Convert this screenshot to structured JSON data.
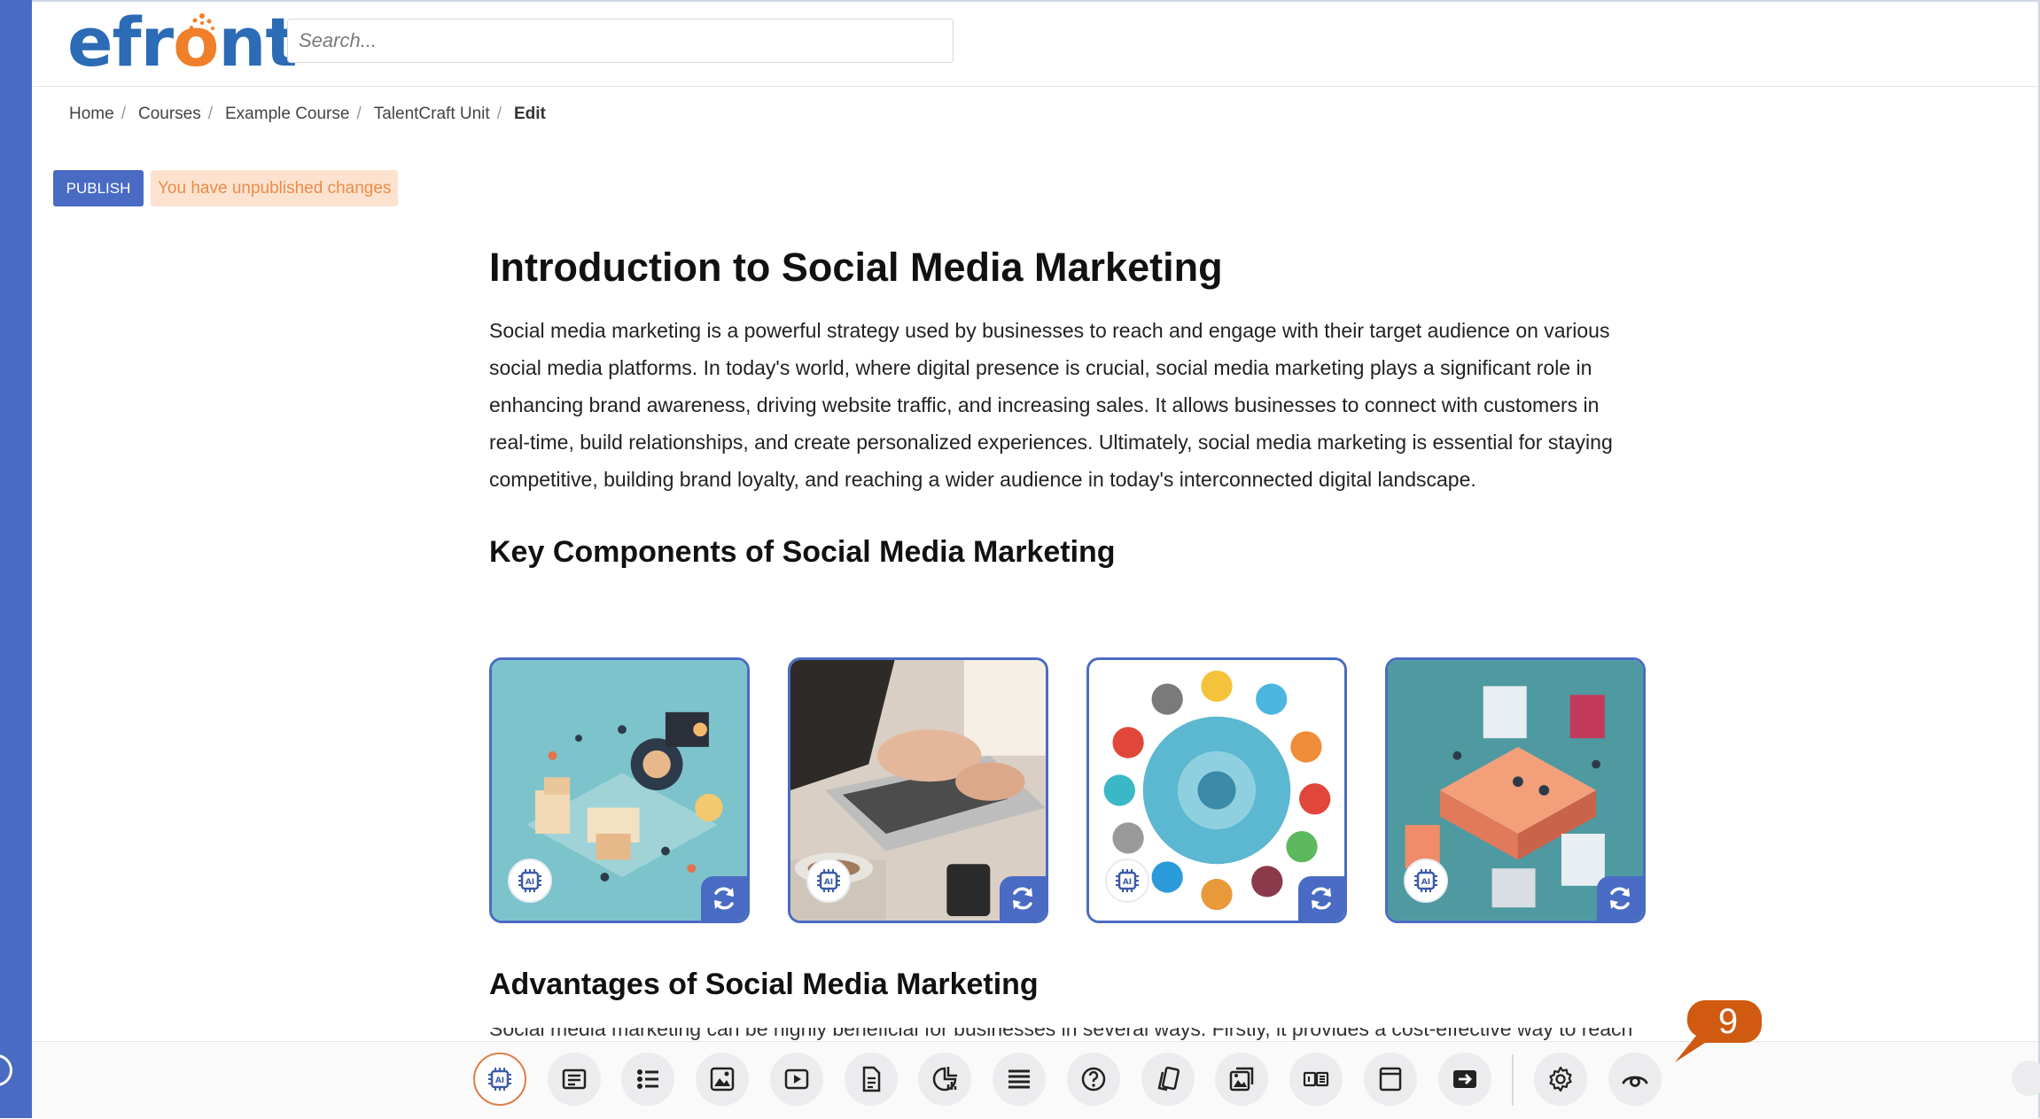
{
  "app": {
    "logo_text_pre": "efr",
    "logo_text_o": "o",
    "logo_text_post": "nt"
  },
  "search": {
    "placeholder": "Search..."
  },
  "breadcrumb": {
    "items": [
      "Home",
      "Courses",
      "Example Course",
      "TalentCraft Unit"
    ],
    "current": "Edit",
    "separator": "/"
  },
  "actions": {
    "publish_label": "PUBLISH",
    "unpublished_notice": "You have unpublished changes"
  },
  "content": {
    "title": "Introduction to Social Media Marketing",
    "intro": "Social media marketing is a powerful strategy used by businesses to reach and engage with their target audience on various social media platforms. In today's world, where digital presence is crucial, social media marketing plays a significant role in enhancing brand awareness, driving website traffic, and increasing sales. It allows businesses to connect with customers in real-time, build relationships, and create personalized experiences. Ultimately, social media marketing is essential for staying competitive, building brand loyalty, and reaching a wider audience in today's interconnected digital landscape.",
    "section1_heading": "Key Components of Social Media Marketing",
    "section2_heading": "Advantages of Social Media Marketing",
    "section2_text_cut": "Social media marketing can be highly beneficial for businesses in several ways. Firstly, it provides a cost-effective way to reach"
  },
  "images": [
    {
      "name": "isometric-city-image",
      "ai_icon": "ai-chip-icon",
      "action_icon": "refresh-icon"
    },
    {
      "name": "laptop-typing-image",
      "ai_icon": "ai-chip-icon",
      "action_icon": "refresh-icon"
    },
    {
      "name": "social-icons-wheel-image",
      "ai_icon": "ai-chip-icon",
      "action_icon": "refresh-icon"
    },
    {
      "name": "isometric-office-image",
      "ai_icon": "ai-chip-icon",
      "action_icon": "refresh-icon"
    }
  ],
  "toolbar": {
    "tools": [
      "ai-chip-icon",
      "text-block-icon",
      "list-icon",
      "image-icon",
      "video-icon",
      "document-icon",
      "chart-icon",
      "menu-lines-icon",
      "question-icon",
      "cards-icon",
      "image-gallery-icon",
      "compare-icon",
      "frame-icon",
      "embed-icon",
      "gear-icon",
      "eye-icon"
    ]
  },
  "callout": {
    "step_number": "9"
  },
  "colors": {
    "accent": "#4a6bc3",
    "callout": "#cf5a10",
    "warning_bg": "#fde3cf",
    "warning_text": "#ec8b4a"
  }
}
